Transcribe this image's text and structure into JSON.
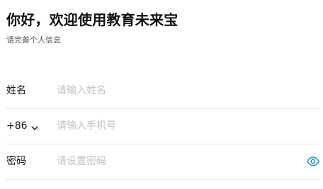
{
  "header": {
    "title": "你好，欢迎使用教育未来宝",
    "subtitle": "请完善个人信息"
  },
  "form": {
    "name": {
      "label": "姓名",
      "placeholder": "请输入姓名",
      "value": ""
    },
    "phone": {
      "country_code": "+86",
      "placeholder": "请输入手机号",
      "value": ""
    },
    "password": {
      "label": "密码",
      "placeholder": "请设置密码",
      "value": "",
      "toggle_icon": "eye-icon"
    }
  },
  "colors": {
    "accent": "#1f8fd6",
    "placeholder": "#c2c2c2",
    "divider": "#e6e6e6"
  }
}
